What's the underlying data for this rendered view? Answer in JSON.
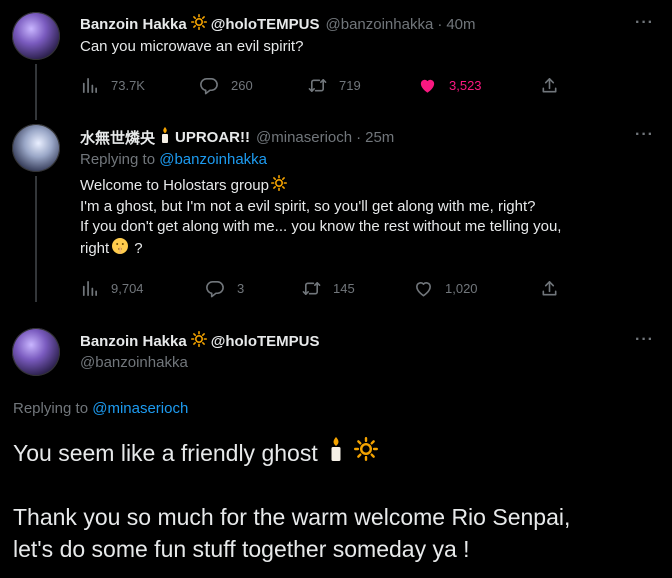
{
  "tweet1": {
    "name": "Banzoin Hakka",
    "name_suffix": "@holoTEMPUS",
    "handle": "@banzoinhakka",
    "sep": "·",
    "time": "40m",
    "text": "Can you microwave an evil spirit?",
    "views": "73.7K",
    "replies": "260",
    "retweets": "719",
    "likes": "3,523"
  },
  "tweet2": {
    "name": "水無世燐央",
    "name_suffix": "UPROAR!!",
    "handle": "@minaserioch",
    "sep": "·",
    "time": "25m",
    "replying_prefix": "Replying to",
    "replying_to": "@banzoinhakka",
    "line1": "Welcome to Holostars group",
    "line2": "I'm a ghost, but I'm not a evil spirit, so you'll get along with me, right?",
    "line3": "If you don't get along with me... you know the rest without me telling you,",
    "line4a": "right",
    "line4b": "?",
    "views": "9,704",
    "replies": "3",
    "retweets": "145",
    "likes": "1,020"
  },
  "tweet3": {
    "name": "Banzoin Hakka",
    "name_suffix": "@holoTEMPUS",
    "handle": "@banzoinhakka",
    "replying_prefix": "Replying to",
    "replying_to": "@minaserioch",
    "line1": "You seem like a friendly ghost",
    "line2": "Thank you so much for the warm welcome Rio Senpai,",
    "line3": "let's do some fun stuff together someday ya !"
  },
  "more_label": "···",
  "colors": {
    "background": "#000000",
    "text": "#e7e9ea",
    "muted": "#71767b",
    "link": "#1d9bf0",
    "like": "#f91880",
    "sun": "#f4a300"
  }
}
